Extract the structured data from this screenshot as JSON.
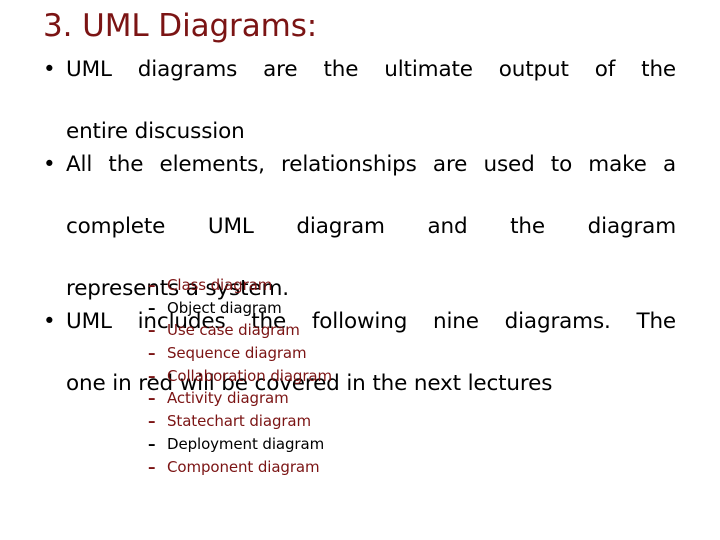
{
  "slide": {
    "background_color": "#ffffff",
    "title": "3. UML Diagrams:",
    "title_color": "#7b1414"
  },
  "colors": {
    "accent_red": "#7b1414",
    "body_black": "#000000"
  },
  "main_list": {
    "bullet_glyph": "•",
    "items": [
      {
        "lines": [
          "UML diagrams are the ultimate output of the",
          "entire discussion"
        ],
        "text": "UML diagrams are the ultimate output of the entire discussion",
        "color": "#000000"
      },
      {
        "lines": [
          "All the elements, relationships are used to make a",
          "complete UML diagram and the diagram",
          "represents a system."
        ],
        "text": "All the elements, relationships are used to make a complete UML diagram and the diagram represents a system.",
        "color": "#000000"
      },
      {
        "lines": [
          "UML includes the following nine diagrams. The",
          "one in red will be covered in the next lectures"
        ],
        "text": "UML includes the following nine diagrams. The one in red will be covered in the next lectures",
        "color": "#000000"
      }
    ]
  },
  "sub_list": {
    "dash_glyph": "–",
    "items": [
      {
        "label": "Class diagram",
        "color": "#7b1414"
      },
      {
        "label": "Object diagram",
        "color": "#000000"
      },
      {
        "label": "Use case diagram",
        "color": "#7b1414"
      },
      {
        "label": "Sequence diagram",
        "color": "#7b1414"
      },
      {
        "label": "Collaboration diagram",
        "color": "#7b1414"
      },
      {
        "label": "Activity diagram",
        "color": "#7b1414"
      },
      {
        "label": "Statechart diagram",
        "color": "#7b1414"
      },
      {
        "label": "Deployment diagram",
        "color": "#000000"
      },
      {
        "label": "Component diagram",
        "color": "#7b1414"
      }
    ]
  }
}
